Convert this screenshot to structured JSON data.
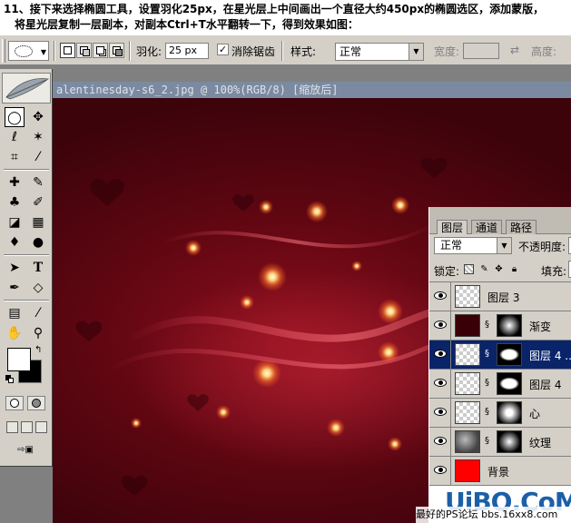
{
  "instructions": {
    "line1": "11、接下来选择椭圆工具，设置羽化25px，在星光层上中间画出一个直径大约450px的椭圆选区，添加蒙版，",
    "line2": "将星光层复制一层副本，对副本Ctrl+T水平翻转一下，得到效果如图："
  },
  "options_bar": {
    "feather_label": "羽化:",
    "feather_value": "25 px",
    "antialias_label": "消除锯齿",
    "antialias_checked": "✓",
    "style_label": "样式:",
    "style_value": "正常",
    "width_label": "宽度:",
    "height_label": "高度:",
    "swap_icon": "⇄"
  },
  "document": {
    "title": "alentinesday-s6_2.jpg @ 100%(RGB/8) [缩放后]"
  },
  "toolbox": {
    "tools": [
      {
        "icon": "◯",
        "name": "marquee"
      },
      {
        "icon": "✥",
        "name": "move"
      },
      {
        "icon": "ℓ",
        "name": "lasso"
      },
      {
        "icon": "✶",
        "name": "magic-wand"
      },
      {
        "icon": "⌗",
        "name": "crop"
      },
      {
        "icon": "⁄",
        "name": "slice"
      },
      {
        "icon": "✚",
        "name": "healing"
      },
      {
        "icon": "✎",
        "name": "brush"
      },
      {
        "icon": "♣",
        "name": "stamp"
      },
      {
        "icon": "✐",
        "name": "history-brush"
      },
      {
        "icon": "◪",
        "name": "eraser"
      },
      {
        "icon": "▦",
        "name": "gradient"
      },
      {
        "icon": "♦",
        "name": "blur"
      },
      {
        "icon": "●",
        "name": "dodge"
      },
      {
        "icon": "➤",
        "name": "path-select"
      },
      {
        "icon": "T",
        "name": "type"
      },
      {
        "icon": "✒",
        "name": "pen"
      },
      {
        "icon": "◇",
        "name": "shape"
      },
      {
        "icon": "▤",
        "name": "notes"
      },
      {
        "icon": "⁄",
        "name": "eyedropper"
      },
      {
        "icon": "✋",
        "name": "hand"
      },
      {
        "icon": "⚲",
        "name": "zoom"
      }
    ],
    "jump_icon": "⇨▣"
  },
  "layers_panel": {
    "tabs": [
      "图层",
      "通道",
      "路径"
    ],
    "blend_mode": "正常",
    "opacity_label": "不透明度:",
    "lock_label": "锁定:",
    "fill_label": "填充:",
    "layers": [
      {
        "name": "图层 3",
        "thumb": "checker",
        "mask": null,
        "selected": false
      },
      {
        "name": "渐变",
        "thumb": "dark",
        "mask": "mask-radial",
        "selected": false
      },
      {
        "name": "图层 4 ..",
        "thumb": "checker",
        "mask": "mask-ellipse",
        "selected": true
      },
      {
        "name": "图层 4",
        "thumb": "checker",
        "mask": "mask-ellipse",
        "selected": false
      },
      {
        "name": "心",
        "thumb": "checker",
        "mask": "mask-soft",
        "selected": false
      },
      {
        "name": "纹理",
        "thumb": "texture",
        "mask": "mask-radial",
        "selected": false
      },
      {
        "name": "背景",
        "thumb": "red",
        "mask": null,
        "selected": false
      }
    ]
  },
  "watermark": {
    "logo": "UiBQ.CoM",
    "sub": "最好的PS论坛 bbs.16xx8.com"
  }
}
